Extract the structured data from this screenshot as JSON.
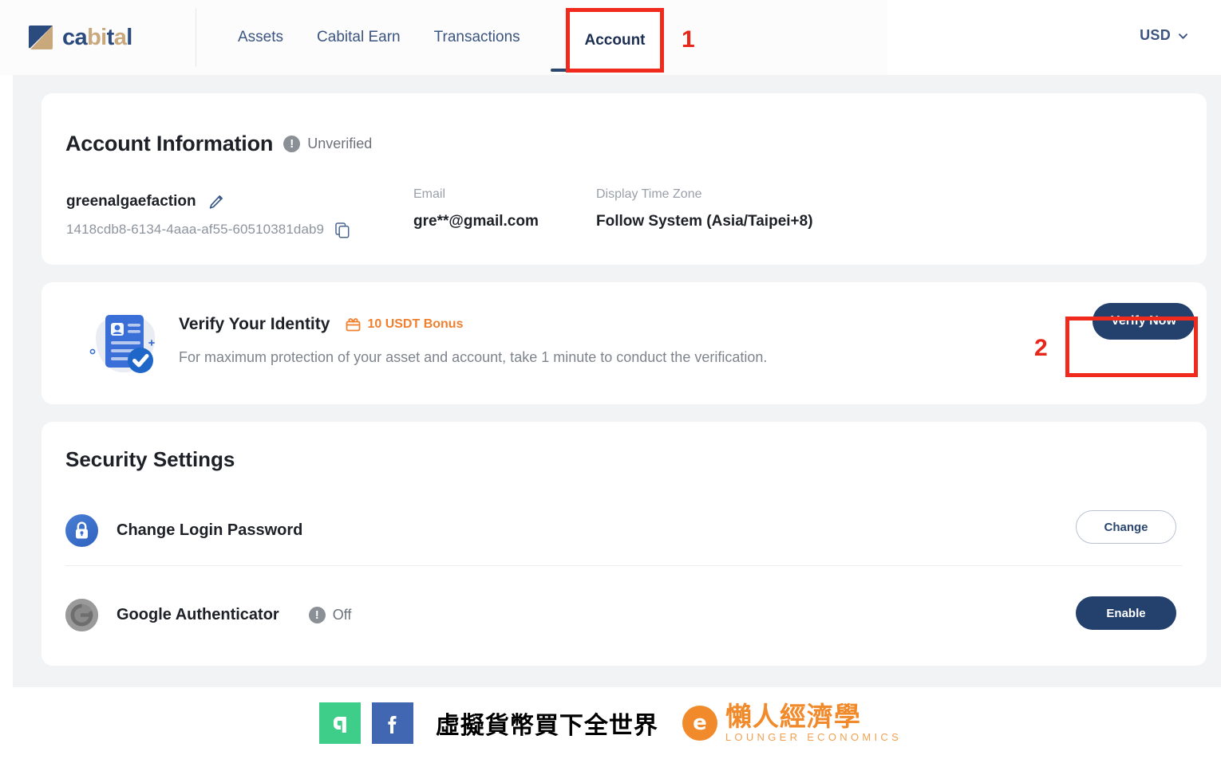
{
  "header": {
    "logo": {
      "text_a": "ca",
      "text_b": "bi",
      "text_c": "t",
      "text_d": "a",
      "text_e": "l",
      "icon": "cabital-logo-icon"
    },
    "nav": [
      {
        "label": "Assets",
        "active": false
      },
      {
        "label": "Cabital Earn",
        "active": false
      },
      {
        "label": "Transactions",
        "active": false
      },
      {
        "label": "Account",
        "active": true
      }
    ],
    "currency": {
      "value": "USD",
      "chevron": "chevron-down-icon"
    }
  },
  "annotations": {
    "step_1": "1",
    "step_2": "2",
    "highlight_color": "#f02b1d"
  },
  "account_information": {
    "title": "Account Information",
    "status_badge": {
      "text": "Unverified",
      "icon": "exclamation-circle-icon"
    },
    "username": "greenalgaefaction",
    "edit_icon": "pencil-icon",
    "user_id": "1418cdb8-6134-4aaa-af55-60510381dab9",
    "copy_icon": "copy-icon",
    "fields": [
      {
        "label": "Email",
        "value": "gre**@gmail.com"
      },
      {
        "label": "Display Time Zone",
        "value": "Follow System (Asia/Taipei+8)"
      }
    ]
  },
  "verify_identity": {
    "icon": "id-card-verified-icon",
    "title": "Verify Your Identity",
    "bonus": {
      "icon": "gift-icon",
      "text": "10 USDT Bonus",
      "color": "#f08030"
    },
    "description": "For maximum protection of your asset and account, take 1 minute to conduct the verification.",
    "button": "Verify Now"
  },
  "security_settings": {
    "title": "Security Settings",
    "rows": [
      {
        "icon": "lock-icon",
        "label": "Change Login Password",
        "status": null,
        "status_icon": null,
        "button": "Change",
        "button_style": "outline"
      },
      {
        "icon": "google-authenticator-icon",
        "label": "Google Authenticator",
        "status": "Off",
        "status_icon": "exclamation-circle-icon",
        "button": "Enable",
        "button_style": "primary"
      }
    ]
  },
  "footer": {
    "line_icon": "line-app-icon",
    "facebook_icon": "facebook-icon",
    "slogan": "虛擬貨幣買下全世界",
    "brand_mark": "lounger-economics-logo-icon",
    "brand_cn": "懶人經濟學",
    "brand_en": "LOUNGER ECONOMICS"
  }
}
